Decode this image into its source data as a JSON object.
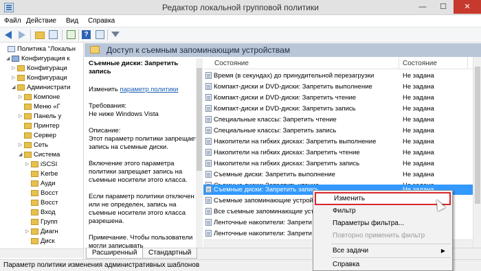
{
  "window": {
    "title": "Редактор локальной групповой политики",
    "controls": {
      "minimize": "—",
      "maximize": "☐",
      "close": "✕"
    }
  },
  "menubar": [
    "Файл",
    "Действие",
    "Вид",
    "Справка"
  ],
  "toolbar": {
    "icons": [
      "back-arrow-icon",
      "forward-arrow-icon",
      "up-folder-icon",
      "show-hide-tree-icon",
      "export-list-icon",
      "help-icon",
      "properties-icon",
      "filter-icon"
    ],
    "help_glyph": "?"
  },
  "tree": {
    "items": [
      {
        "label": "Политика \"Локальн",
        "icon": "policy",
        "expander": ""
      },
      {
        "label": "Конфигурация к",
        "icon": "comp",
        "expander": "◢"
      },
      {
        "label": "Конфигураци",
        "icon": "folder",
        "expander": "▷"
      },
      {
        "label": "Конфигураци",
        "icon": "folder",
        "expander": "▷"
      },
      {
        "label": "Администрати",
        "icon": "folder",
        "expander": "◢"
      },
      {
        "label": "Компоне",
        "icon": "folder",
        "expander": "▷"
      },
      {
        "label": "Меню «Г",
        "icon": "folder",
        "expander": ""
      },
      {
        "label": "Панель у",
        "icon": "folder",
        "expander": "▷"
      },
      {
        "label": "Принтер",
        "icon": "folder",
        "expander": ""
      },
      {
        "label": "Сервер",
        "icon": "folder",
        "expander": ""
      },
      {
        "label": "Сеть",
        "icon": "folder",
        "expander": "▷"
      },
      {
        "label": "Система",
        "icon": "folder",
        "expander": "◢"
      },
      {
        "label": "iSCSI",
        "icon": "folder",
        "expander": "▷"
      },
      {
        "label": "Kerbe",
        "icon": "folder",
        "expander": ""
      },
      {
        "label": "Ауди",
        "icon": "folder",
        "expander": ""
      },
      {
        "label": "Восст",
        "icon": "folder",
        "expander": ""
      },
      {
        "label": "Восст",
        "icon": "folder",
        "expander": ""
      },
      {
        "label": "Вход",
        "icon": "folder",
        "expander": ""
      },
      {
        "label": "Групп",
        "icon": "folder",
        "expander": ""
      },
      {
        "label": "Диагн",
        "icon": "folder",
        "expander": "▷"
      },
      {
        "label": "Диск",
        "icon": "folder",
        "expander": ""
      }
    ]
  },
  "header": {
    "title": "Доступ к съемным запоминающим устройствам"
  },
  "description": {
    "title": "Съемные диски: Запретить запись",
    "edit_prefix": "Изменить ",
    "edit_link": "параметр политики",
    "requirements_label": "Требования:",
    "requirements_value": "Не ниже Windows Vista",
    "description_label": "Описание:",
    "description_text": "Этот параметр политики запрещает запись на съемные диски.",
    "para_enabled": "Включение этого параметра политики запрещает запись на съемные носители этого класса.",
    "para_disabled": "Если параметр политики отключен или не определен, запись на съемные носители этого класса разрешена.",
    "para_note": "Примечание. Чтобы пользователи могли записывать"
  },
  "list": {
    "columns": {
      "name": "Состояние",
      "state": "Состояние"
    },
    "rows": [
      {
        "name": "Время (в секундах) до принудительной перезагрузки",
        "state": "Не задана"
      },
      {
        "name": "Компакт-диски и DVD-диски: Запретить выполнение",
        "state": "Не задана"
      },
      {
        "name": "Компакт-диски и DVD-диски: Запретить чтение",
        "state": "Не задана"
      },
      {
        "name": "Компакт-диски и DVD-диски: Запретить запись",
        "state": "Не задана"
      },
      {
        "name": "Специальные классы: Запретить чтение",
        "state": "Не задана"
      },
      {
        "name": "Специальные классы: Запретить запись",
        "state": "Не задана"
      },
      {
        "name": "Накопители на гибких дисках: Запретить выполнение",
        "state": "Не задана"
      },
      {
        "name": "Накопители на гибких дисках: Запретить чтение",
        "state": "Не задана"
      },
      {
        "name": "Накопители на гибких дисках: Запретить запись",
        "state": "Не задана"
      },
      {
        "name": "Съемные диски: Запретить выполнение",
        "state": "Не задана"
      },
      {
        "name": "Съемные диски: Запретить чтение",
        "state": "Не задана"
      },
      {
        "name": "Съемные диски: Запретить запись",
        "state": "Не задана",
        "selected": true
      },
      {
        "name": "Съемные запоминающие устрой",
        "state": ""
      },
      {
        "name": "Все съемные запоминающие устр",
        "state": ""
      },
      {
        "name": "Ленточные накопители: Запрети",
        "state": ""
      },
      {
        "name": "Ленточные накопители: Запрети",
        "state": ""
      }
    ]
  },
  "tabs": [
    "Расширенный",
    "Стандартный"
  ],
  "status": "Параметр политики изменения административных шаблонов",
  "context_menu": {
    "items": [
      {
        "label": "Изменить",
        "highlighted": true
      },
      {
        "label": "Фильтр"
      },
      {
        "label": "Параметры фильтра..."
      },
      {
        "label": "Повторно применить фильтр",
        "disabled": true
      },
      {
        "label": "Все задачи",
        "submenu": "▶"
      },
      {
        "label": "Справка"
      }
    ]
  },
  "colors": {
    "selection": "#3399ff",
    "header_band": "#b9c6d8",
    "highlight_border": "#d8262b",
    "close_button": "#c7392d"
  }
}
